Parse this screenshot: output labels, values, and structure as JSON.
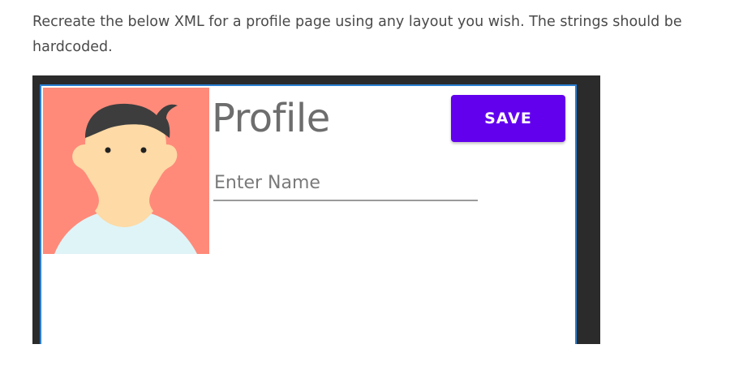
{
  "instructions": {
    "text": "Recreate the below XML for a profile page using any layout you wish. The strings should be hardcoded."
  },
  "profile": {
    "title": "Profile",
    "save_label": "SAVE",
    "name_placeholder": "Enter Name",
    "name_value": ""
  },
  "colors": {
    "save_button": "#6200ee",
    "avatar_background": "#ff8a7a",
    "avatar_skin": "#fddaa6",
    "avatar_hair": "#3d3d3d",
    "avatar_shirt": "#dff4f7",
    "screen_border": "#2a7fd4",
    "frame": "#2b2b2b"
  },
  "icons": {
    "avatar": "person-avatar-icon"
  }
}
